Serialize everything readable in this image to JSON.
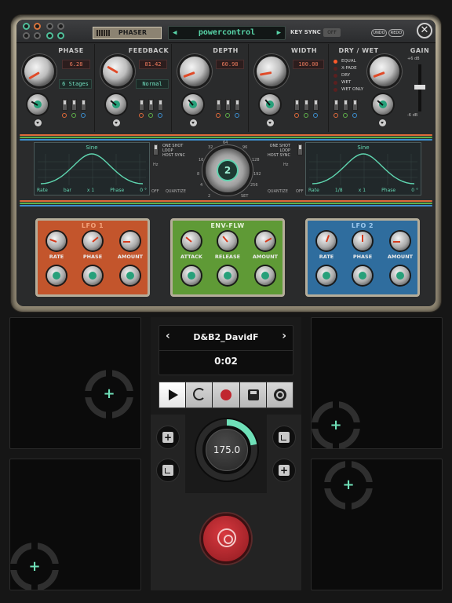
{
  "plugin": {
    "preset_label": "PHASER",
    "preset_name": "powercontrol",
    "prev_preset": "◀",
    "next_preset": "▶",
    "key_sync_label": "KEY SYNC",
    "key_sync_state": "OFF",
    "undo_label": "UNDO",
    "redo_label": "REDO",
    "close_glyph": "✕",
    "sections": {
      "phase": {
        "title": "PHASE",
        "value": "6.28",
        "mode": "6 Stages"
      },
      "feedback": {
        "title": "FEEDBACK",
        "value": "81.42",
        "mode": "Normal"
      },
      "depth": {
        "title": "DEPTH",
        "value": "60.98"
      },
      "width": {
        "title": "WIDTH",
        "value": "100.00"
      },
      "drywet": {
        "title": "DRY / WET",
        "options": [
          "EQUAL",
          "X-FADE",
          "DRY",
          "WET",
          "WET ONLY"
        ],
        "selected": "EQUAL"
      },
      "gain": {
        "title": "GAIN",
        "max": "+6 dB",
        "min": "-6 dB"
      }
    },
    "lfo_panel": {
      "left": {
        "shape": "Sine",
        "rate_label": "Rate",
        "rate_unit": "bar",
        "rate_mult": "x 1",
        "phase_label": "Phase",
        "phase_value": "0 °"
      },
      "right": {
        "shape": "Sine",
        "rate_label": "Rate",
        "rate_unit": "1/8",
        "rate_mult": "x 1",
        "phase_label": "Phase",
        "phase_value": "0 °"
      },
      "modes": [
        "ONE SHOT",
        "LOOP",
        "HOST SYNC"
      ],
      "quantize": "QUANTIZE",
      "hz": "Hz",
      "off": "OFF",
      "dial_value": "2",
      "dial_marks": [
        "64",
        "32",
        "96",
        "16",
        "128",
        "8",
        "192",
        "4",
        "256",
        "2",
        "SET"
      ]
    },
    "modules": [
      {
        "title": "LFO 1",
        "labels": [
          "RATE",
          "PHASE",
          "AMOUNT"
        ]
      },
      {
        "title": "ENV-FLW",
        "labels": [
          "ATTACK",
          "RELEASE",
          "AMOUNT"
        ]
      },
      {
        "title": "LFO 2",
        "labels": [
          "RATE",
          "PHASE",
          "AMOUNT"
        ]
      }
    ],
    "colors": {
      "lfo1": "#c3552c",
      "env": "#5f9a36",
      "lfo2": "#2f6d9e",
      "accent": "#58d6a9"
    }
  },
  "transport": {
    "prev": "‹",
    "next": "›",
    "track_name": "D&B2_DavidF",
    "time": "0:02"
  },
  "tempo": {
    "bpm": "175.0",
    "ring_fraction": 0.22
  },
  "side_buttons": {
    "plus": "+"
  },
  "xy_pads": {
    "plus": "+"
  }
}
